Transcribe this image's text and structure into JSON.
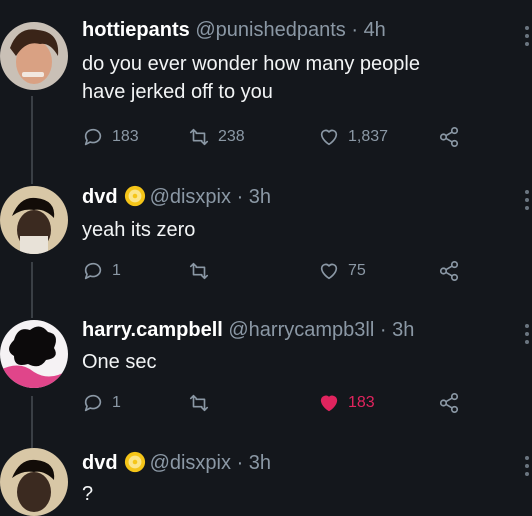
{
  "tweets": [
    {
      "display_name": "hottiepants",
      "handle": "@punishedpants",
      "separator": "·",
      "time": "4h",
      "verified": false,
      "text_lines": [
        "do you ever wonder how many people",
        "have jerked off to you"
      ],
      "replies": "183",
      "retweets": "238",
      "likes": "1,837",
      "liked": false
    },
    {
      "display_name": "dvd",
      "handle": "@disxpix",
      "separator": "·",
      "time": "3h",
      "verified": true,
      "text_lines": [
        "yeah its zero"
      ],
      "replies": "1",
      "retweets": "",
      "likes": "75",
      "liked": false
    },
    {
      "display_name": "harry.campbell",
      "handle": "@harrycampb3ll",
      "separator": "·",
      "time": "3h",
      "verified": false,
      "text_lines": [
        "One sec"
      ],
      "replies": "1",
      "retweets": "",
      "likes": "183",
      "liked": true
    },
    {
      "display_name": "dvd",
      "handle": "@disxpix",
      "separator": "·",
      "time": "3h",
      "verified": true,
      "text_lines": [
        "?"
      ],
      "replies": "",
      "retweets": "",
      "likes": "",
      "liked": false
    }
  ],
  "colors": {
    "background": "#14171c",
    "muted": "#8b98a5",
    "like_active": "#e0245e",
    "verified_badge": "#f5c518"
  },
  "icons": {
    "reply": "reply-icon",
    "retweet": "retweet-icon",
    "like": "heart-icon",
    "share": "share-icon",
    "more": "more-icon",
    "verified": "verified-badge-icon"
  }
}
